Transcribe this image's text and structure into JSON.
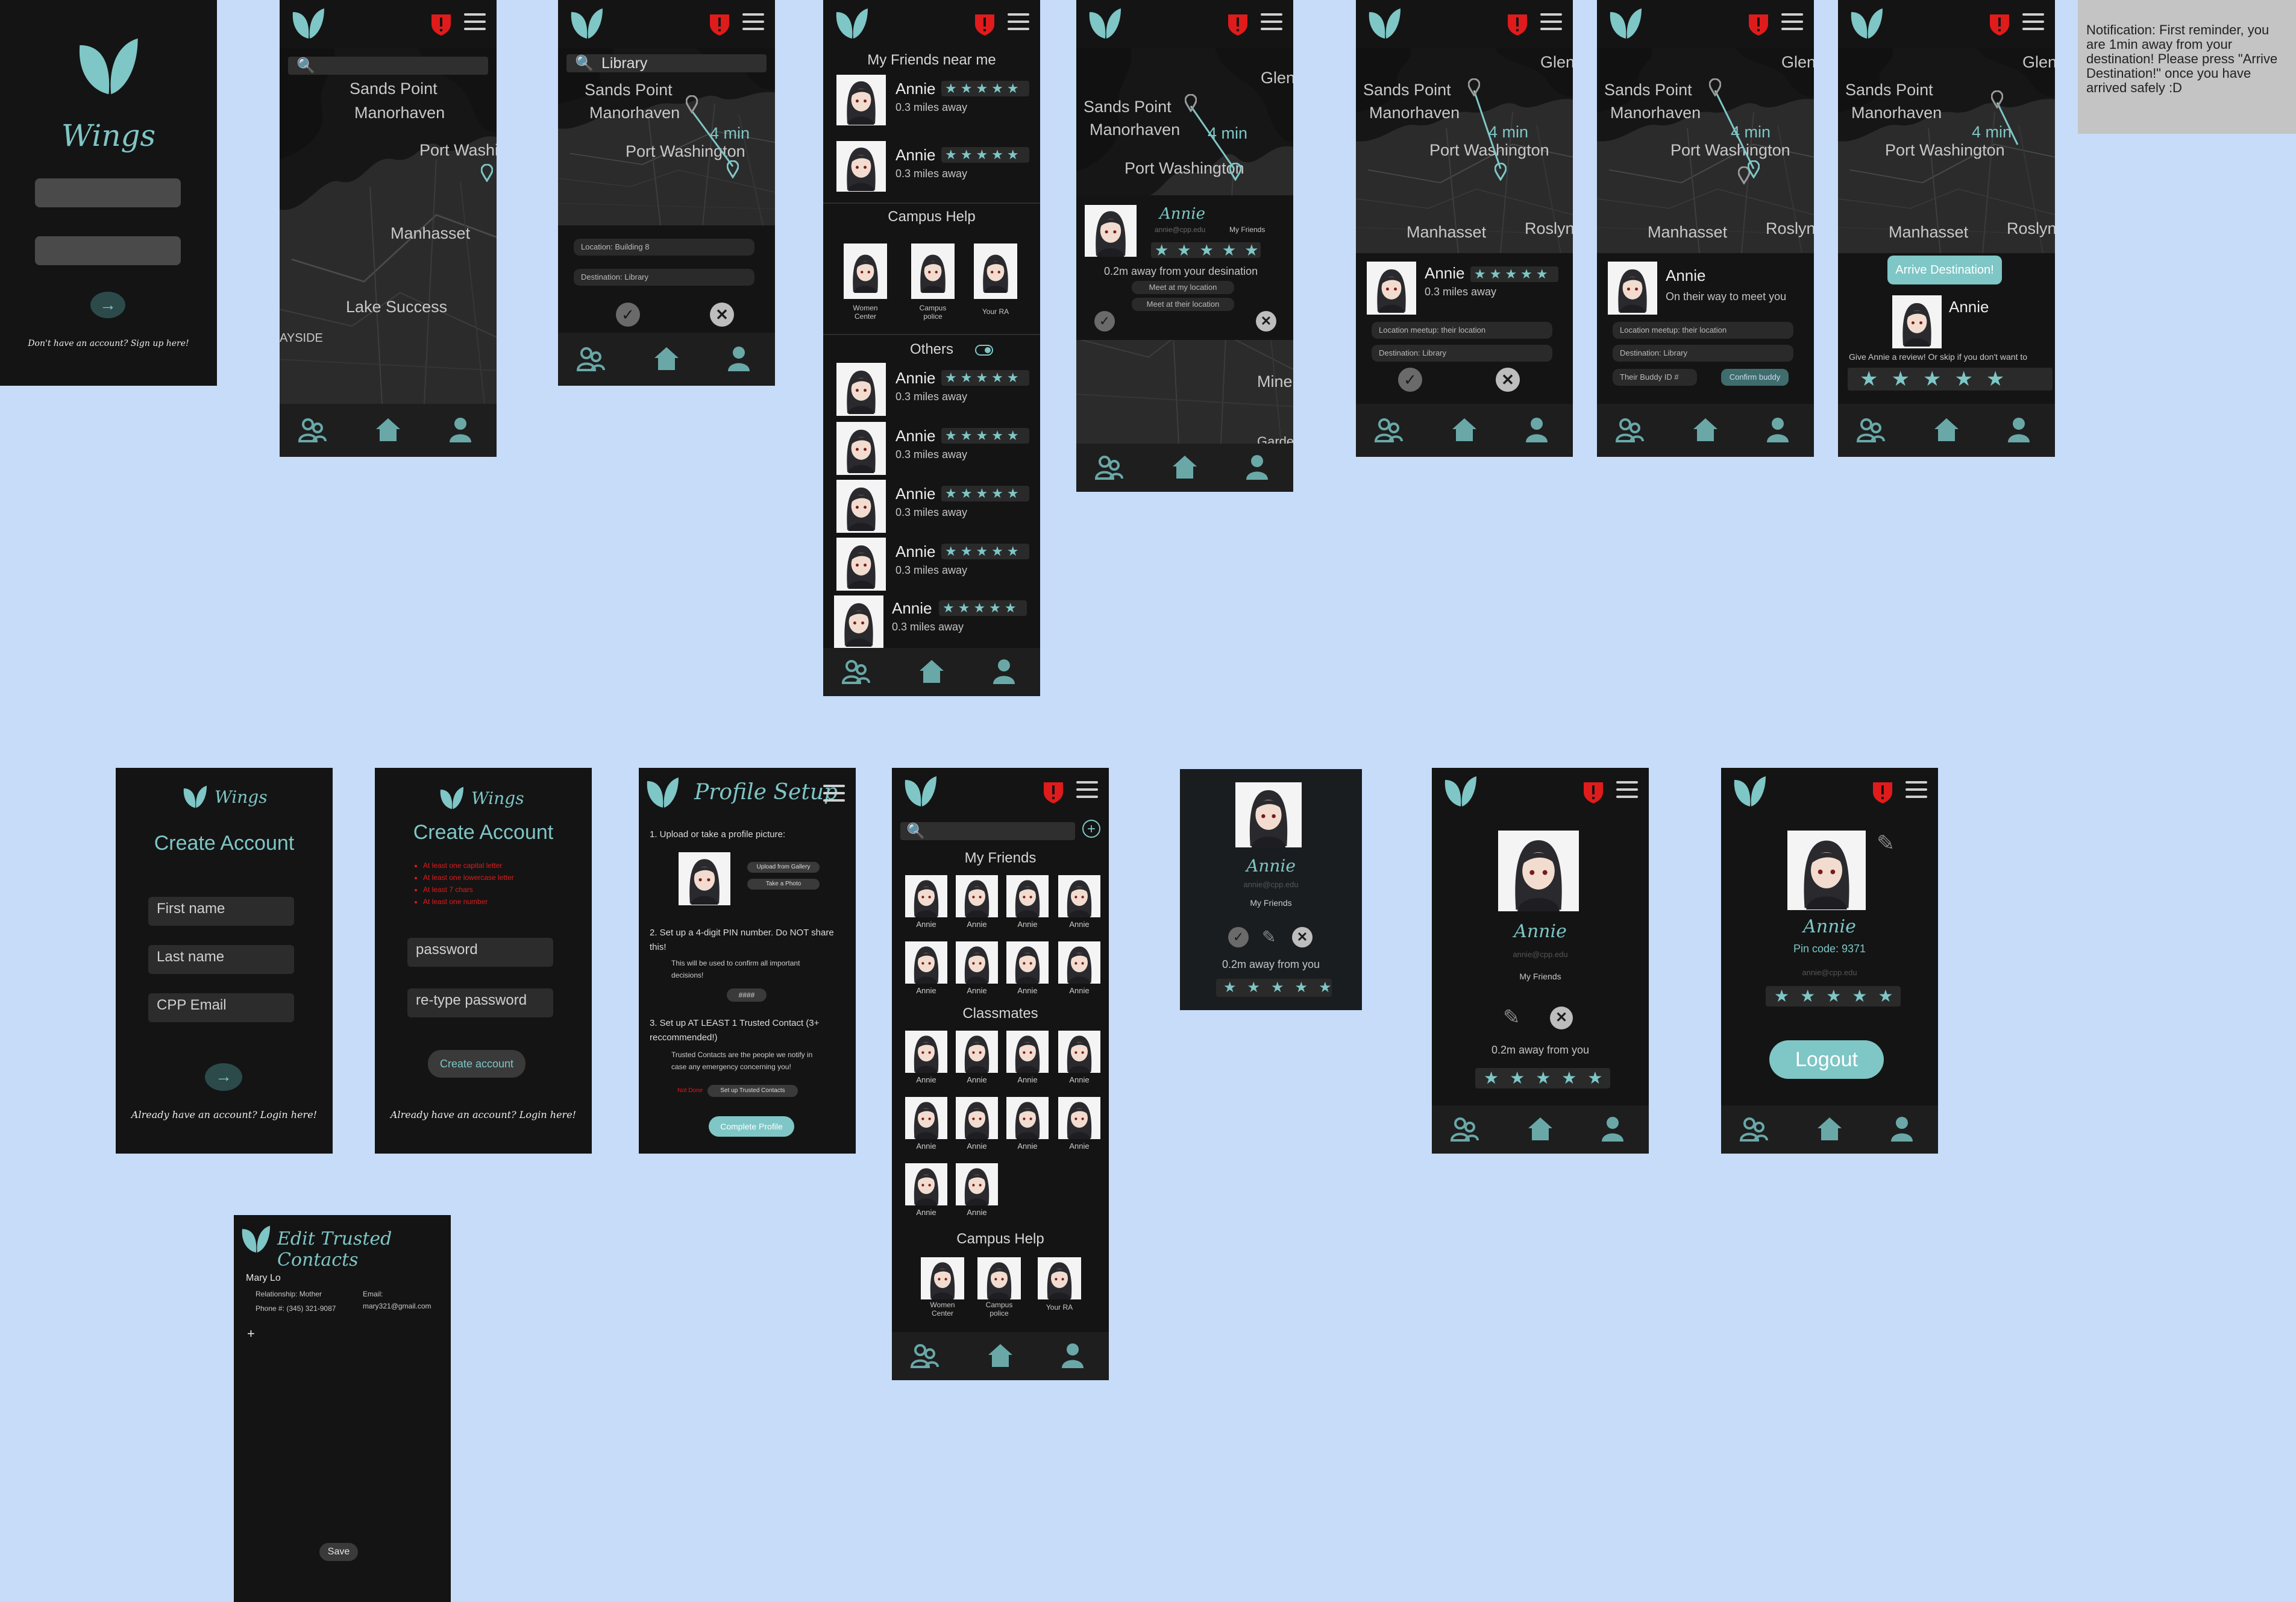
{
  "app_name": "Wings",
  "colors": {
    "background": "#c6dcf9",
    "screen": "#141414",
    "accent": "#7fc6c6",
    "alert": "#e01b1b"
  },
  "login": {
    "app_title": "Wings",
    "signup_text": "Don't have an account? Sign up here!"
  },
  "map": {
    "labels": {
      "sands_point": "Sands Point",
      "manorhaven": "Manorhaven",
      "port_washington": "Port Washington",
      "manhasset": "Manhasset",
      "lake_success": "Lake Success",
      "roslyn": "Roslyn",
      "glen": "Glen",
      "mine": "Mine",
      "ayside": "AYSIDE",
      "garden": "Garde"
    },
    "route_time": "4 min"
  },
  "search": {
    "query": "Library"
  },
  "request": {
    "location": "Location:  Building 8",
    "destination": "Destination: Library"
  },
  "friends_list": {
    "near_title": "My Friends near me",
    "campus_help_title": "Campus Help",
    "others_title": "Others",
    "person": {
      "name": "Annie",
      "distance": "0.3 miles away"
    },
    "campus_help": [
      {
        "label": "Women Center"
      },
      {
        "label": "Campus police"
      },
      {
        "label": "Your RA"
      }
    ]
  },
  "match": {
    "name": "Annie",
    "email": "annie@cpp.edu",
    "my_friends": "My Friends",
    "away_text": "0.2m away from your desination",
    "meet_mine": "Meet at my location",
    "meet_theirs": "Meet at their location"
  },
  "meetup": {
    "name": "Annie",
    "distance": "0.3 miles away",
    "on_way": "On their way to meet you",
    "meetup_location": "Location meetup:  their location",
    "destination": "Destination: Library",
    "buddy_id": "Their Buddy ID #",
    "confirm": "Confirm buddy"
  },
  "arrive": {
    "button": "Arrive Destination!",
    "name": "Annie",
    "review": "Give Annie a review! Or skip if you don't want to"
  },
  "notification": "Notification: First reminder, you are 1min away from your destination! Please press \"Arrive Destination!\" once you have arrived safely :D",
  "create_account_1": {
    "title": "Create Account",
    "first_name": "First name",
    "last_name": "Last name",
    "email": "CPP Email",
    "login_text": "Already have an account? Login here!"
  },
  "create_account_2": {
    "title": "Create Account",
    "rules": [
      "At least one capital letter",
      "At least one lowercase letter",
      "At least 7 chars",
      "At least one number"
    ],
    "password": "password",
    "retype": "re-type password",
    "button": "Create account",
    "login_text": "Already have an account? Login here!"
  },
  "profile_setup": {
    "title": "Profile Setup",
    "step1": "1. Upload or take a profile picture:",
    "upload": "Upload from Gallery",
    "take_photo": "Take a Photo",
    "step2": "2. Set up a 4-digit PIN number. Do NOT share this!",
    "step2_note": "This will be used to confirm all important decisions!",
    "pin_placeholder": "####",
    "step3": "3. Set up AT LEAST 1 Trusted Contact (3+ reccommended!)",
    "step3_note": "Trusted Contacts are the people we notify in case any emergency concerning you!",
    "not_done": "Not Done",
    "setup_contacts": "Set up Trusted Contacts",
    "complete": "Complete Profile"
  },
  "friends_grid": {
    "my_friends_title": "My Friends",
    "classmates_title": "Classmates",
    "campus_help_title": "Campus Help",
    "person_label": "Annie",
    "campus_help": [
      {
        "label": "Women Center"
      },
      {
        "label": "Campus police"
      },
      {
        "label": "Your RA"
      }
    ]
  },
  "profile_card": {
    "name": "Annie",
    "email": "annie@cpp.edu",
    "my_friends": "My Friends",
    "away": "0.2m away from you"
  },
  "profile_page": {
    "name": "Annie",
    "email": "annie@cpp.edu",
    "my_friends": "My Friends",
    "away": "0.2m away from you"
  },
  "own_profile": {
    "name": "Annie",
    "pin": "Pin code: 9371",
    "email": "annie@cpp.edu",
    "logout": "Logout"
  },
  "trusted_contacts": {
    "title": "Edit Trusted Contacts",
    "contact_name": "Mary Lo",
    "relationship": "Relationship: Mother",
    "phone": "Phone #: (345) 321-9087",
    "email_label": "Email:",
    "email": "mary321@gmail.com",
    "add": "+",
    "save": "Save"
  }
}
